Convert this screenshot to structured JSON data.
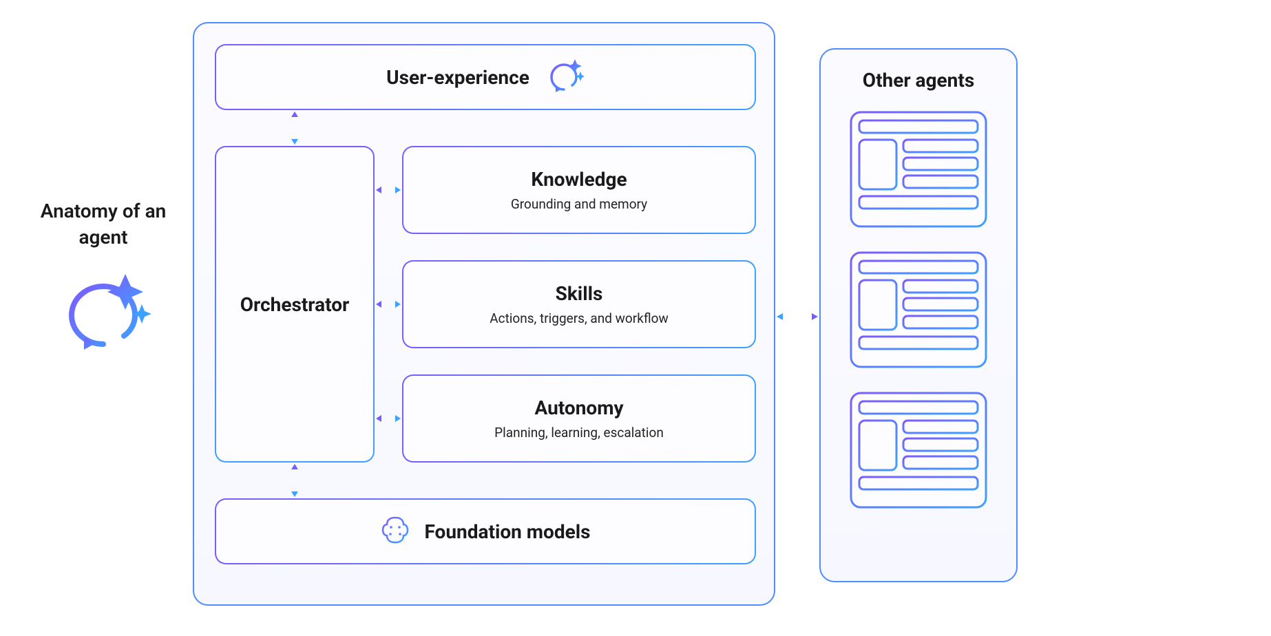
{
  "title": "Anatomy of an agent",
  "agent": {
    "user_experience": {
      "label": "User-experience"
    },
    "orchestrator": {
      "label": "Orchestrator"
    },
    "capabilities": {
      "knowledge": {
        "label": "Knowledge",
        "subtitle": "Grounding and memory"
      },
      "skills": {
        "label": "Skills",
        "subtitle": "Actions, triggers, and workflow"
      },
      "autonomy": {
        "label": "Autonomy",
        "subtitle": "Planning, learning, escalation"
      }
    },
    "foundation_models": {
      "label": "Foundation models"
    }
  },
  "other_agents": {
    "label": "Other agents"
  },
  "colors": {
    "grad_start": "#7b5cff",
    "grad_end": "#3ea0ff",
    "outer_border": "#4f8cff",
    "bg_tint": "#f8f9ff"
  }
}
